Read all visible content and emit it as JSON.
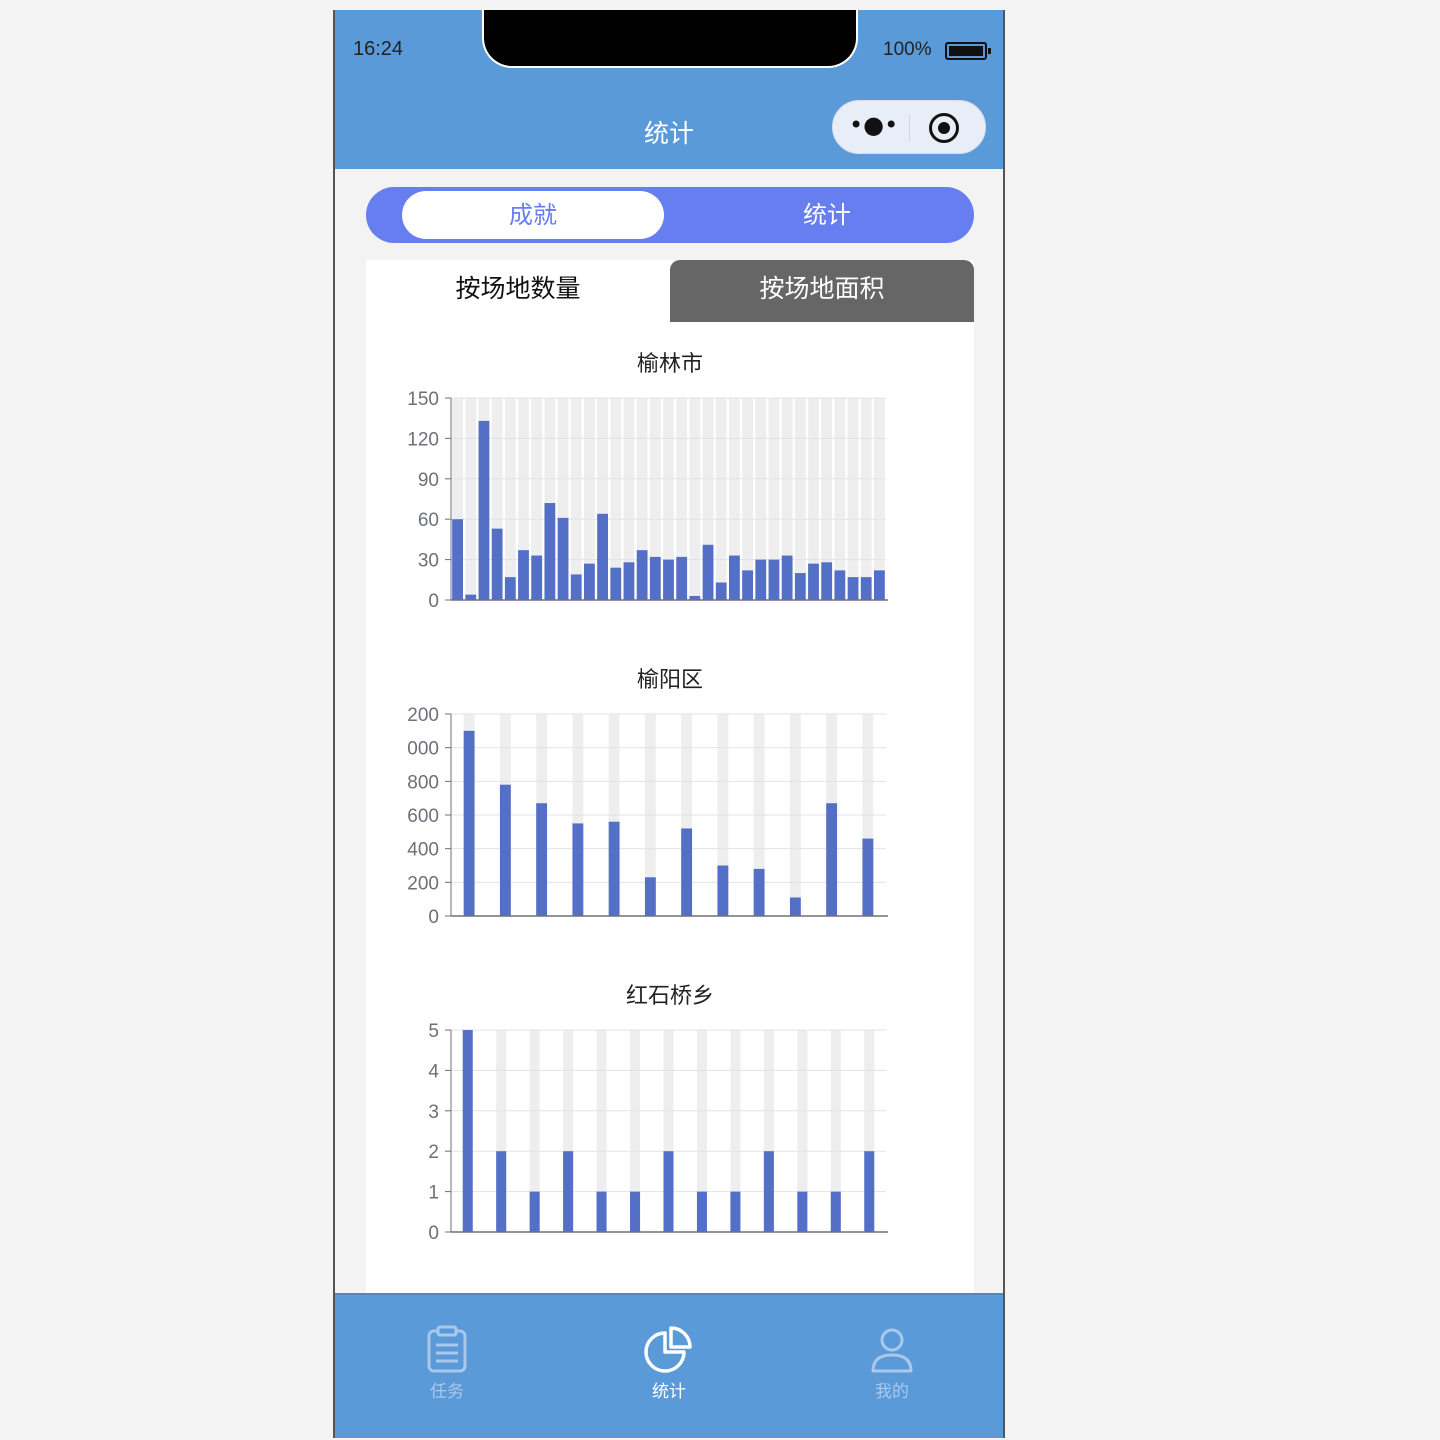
{
  "status_bar": {
    "time": "16:24",
    "battery": "100%"
  },
  "nav": {
    "title": "统计"
  },
  "segment": {
    "active": "成就",
    "inactive": "统计"
  },
  "tabs": {
    "active": "按场地数量",
    "inactive": "按场地面积"
  },
  "theme": {
    "bar_color": "#5470c6",
    "accent": "#667ef0",
    "nav_color": "#5b9ad8"
  },
  "chart_data": [
    {
      "type": "bar",
      "title": "榆林市",
      "ylim": [
        0,
        150
      ],
      "yticks": [
        "0",
        "30",
        "60",
        "90",
        "120",
        "150"
      ],
      "values": [
        60,
        4,
        133,
        53,
        17,
        37,
        33,
        72,
        61,
        19,
        27,
        64,
        24,
        28,
        37,
        32,
        30,
        32,
        3,
        41,
        13,
        33,
        22,
        30,
        30,
        33,
        20,
        27,
        28,
        22,
        17,
        17,
        22
      ]
    },
    {
      "type": "bar",
      "title": "榆阳区",
      "ylim": [
        0,
        1200
      ],
      "yticks": [
        "0",
        "200",
        "400",
        "600",
        "800",
        "000",
        "200"
      ],
      "values": [
        1100,
        780,
        670,
        550,
        560,
        230,
        520,
        300,
        280,
        110,
        670,
        460
      ]
    },
    {
      "type": "bar",
      "title": "红石桥乡",
      "ylim": [
        0,
        5
      ],
      "yticks": [
        "0",
        "1",
        "2",
        "3",
        "4",
        "5"
      ],
      "values": [
        5,
        2,
        1,
        2,
        1,
        1,
        2,
        1,
        1,
        2,
        1,
        1,
        2
      ]
    }
  ],
  "tabbar": {
    "items": [
      {
        "label": "任务",
        "icon": "clipboard-icon"
      },
      {
        "label": "统计",
        "icon": "pie-chart-icon"
      },
      {
        "label": "我的",
        "icon": "user-icon"
      }
    ]
  }
}
